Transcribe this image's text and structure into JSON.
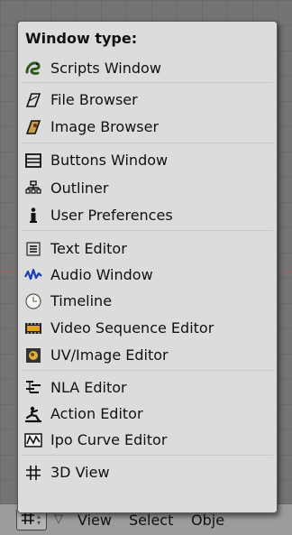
{
  "menu": {
    "title": "Window type:",
    "items": [
      {
        "label": "Scripts Window",
        "icon": "scripts-icon"
      },
      {
        "label": "File Browser",
        "icon": "file-browser-icon"
      },
      {
        "label": "Image Browser",
        "icon": "image-browser-icon"
      },
      {
        "label": "Buttons Window",
        "icon": "buttons-window-icon"
      },
      {
        "label": "Outliner",
        "icon": "outliner-icon"
      },
      {
        "label": "User Preferences",
        "icon": "user-preferences-icon"
      },
      {
        "label": "Text Editor",
        "icon": "text-editor-icon"
      },
      {
        "label": "Audio Window",
        "icon": "audio-window-icon"
      },
      {
        "label": "Timeline",
        "icon": "timeline-icon"
      },
      {
        "label": "Video Sequence Editor",
        "icon": "video-sequence-icon"
      },
      {
        "label": "UV/Image Editor",
        "icon": "uv-image-editor-icon"
      },
      {
        "label": "NLA Editor",
        "icon": "nla-editor-icon"
      },
      {
        "label": "Action Editor",
        "icon": "action-editor-icon"
      },
      {
        "label": "Ipo Curve Editor",
        "icon": "ipo-curve-editor-icon"
      },
      {
        "label": "3D View",
        "icon": "3d-view-icon"
      }
    ]
  },
  "header": {
    "menus": [
      "View",
      "Select",
      "Obje"
    ]
  }
}
